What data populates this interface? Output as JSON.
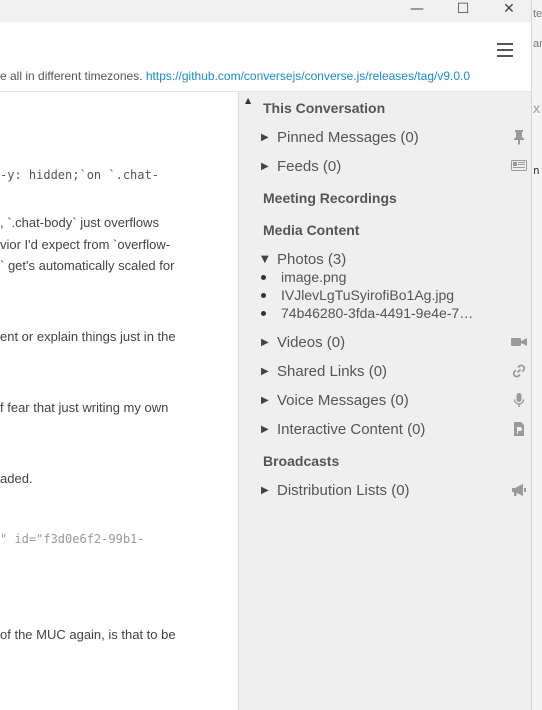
{
  "window": {
    "minimize_glyph": "—",
    "maximize_glyph": "☐",
    "close_glyph": "✕"
  },
  "background_window": {
    "text1": "te",
    "text2": "am",
    "text3": "x",
    "text4": "n.j"
  },
  "header": {
    "topic_text": "e all in different timezones. ",
    "topic_link": "https://github.com/conversejs/converse.js/releases/tag/v9.0.0"
  },
  "chat_lines": [
    {
      "text": "-y: hidden;`on `.chat-",
      "style": "mono"
    },
    {
      "text": ", `.chat-body` just overflows",
      "style": "mixed"
    },
    {
      "text": "vior I'd expect from `overflow-",
      "style": "mixed"
    },
    {
      "text": "` get's automatically scaled for",
      "style": "text"
    },
    {
      "text": "ent or explain things just in the",
      "style": "text"
    },
    {
      "text": "f fear that just writing my own",
      "style": "text"
    },
    {
      "text": "aded.",
      "style": "text"
    },
    {
      "text": "\" id=\"f3d0e6f2-99b1-",
      "style": "mono-grey"
    },
    {
      "text": "of the MUC again, is that to be",
      "style": "text"
    }
  ],
  "sidebar": {
    "scroll_up_glyph": "▲",
    "this_conversation": "This Conversation",
    "pinned_messages": "Pinned Messages (0)",
    "feeds": "Feeds (0)",
    "meeting_recordings": "Meeting Recordings",
    "media_content": "Media Content",
    "photos": "Photos (3)",
    "photo_files": [
      "image.png",
      "IVJlevLgTuSyirofiBo1Ag.jpg",
      "74b46280-3fda-4491-9e4e-7…"
    ],
    "videos": "Videos (0)",
    "shared_links": "Shared Links (0)",
    "voice_messages": "Voice Messages (0)",
    "interactive_content": "Interactive Content (0)",
    "broadcasts": "Broadcasts",
    "distribution_lists": "Distribution Lists (0)",
    "collapsed_arrow": "▶",
    "expanded_arrow": "▼"
  },
  "icons": {
    "pin": "pin-icon",
    "feed": "feed-icon",
    "video": "video-camera-icon",
    "link": "link-icon",
    "mic": "microphone-icon",
    "doc": "document-icon",
    "megaphone": "megaphone-icon"
  }
}
